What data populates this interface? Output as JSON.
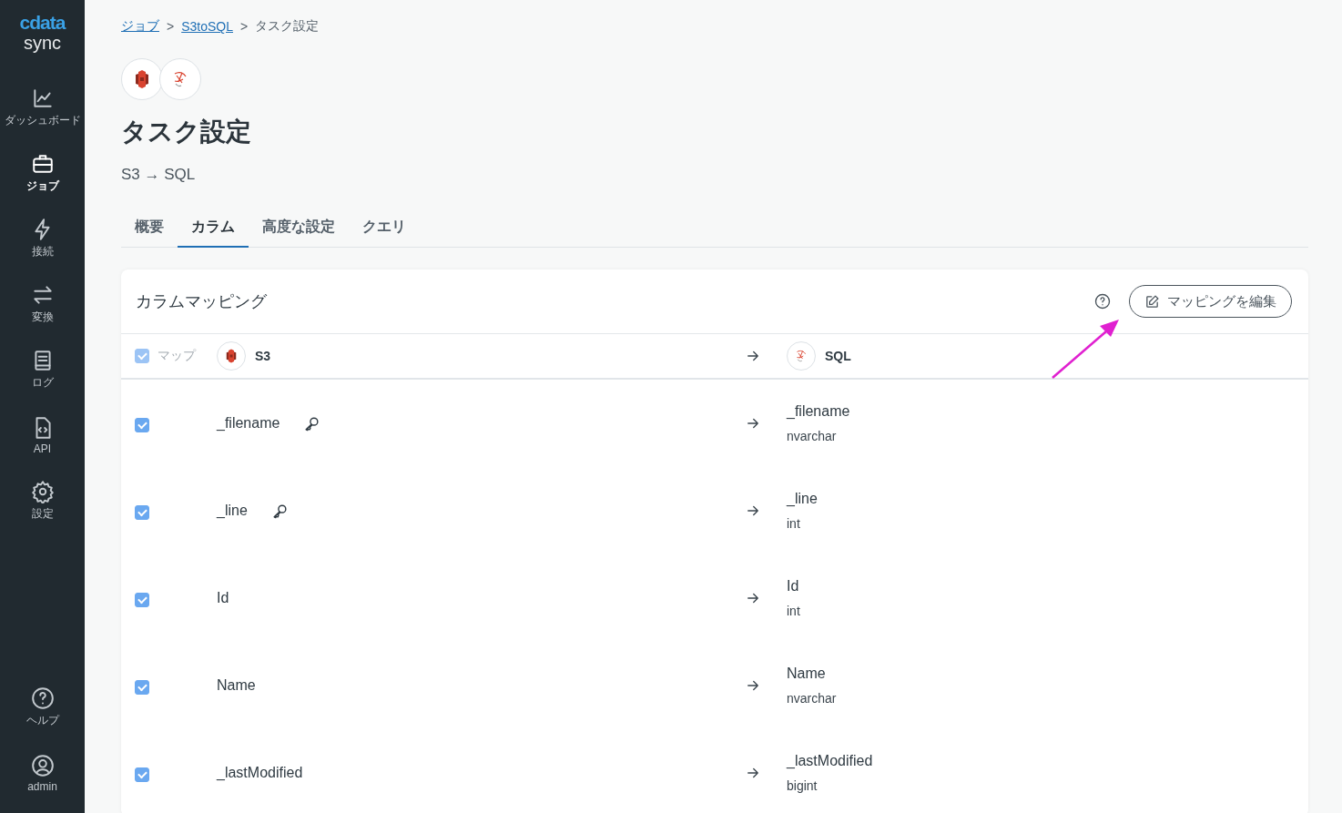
{
  "sidebar": {
    "logo": {
      "brand": "cdata",
      "product": "sync"
    },
    "items": [
      {
        "label": "ダッシュボード",
        "selected": false
      },
      {
        "label": "ジョブ",
        "selected": true
      },
      {
        "label": "接続",
        "selected": false
      },
      {
        "label": "変換",
        "selected": false
      },
      {
        "label": "ログ",
        "selected": false
      },
      {
        "label": "API",
        "selected": false
      },
      {
        "label": "設定",
        "selected": false
      }
    ],
    "bottom_items": [
      {
        "label": "ヘルプ",
        "selected": false
      },
      {
        "label": "admin",
        "selected": false
      }
    ]
  },
  "breadcrumb": [
    {
      "label": "ジョブ",
      "kind": "link"
    },
    {
      "label": "S3toSQL",
      "kind": "link"
    },
    {
      "label": "タスク設定",
      "kind": "current"
    }
  ],
  "breadcrumb_separator": ">",
  "title": "タスク設定",
  "subtitle": "S3 → SQL",
  "tabs": [
    {
      "label": "概要",
      "selected": false
    },
    {
      "label": "カラム",
      "selected": true
    },
    {
      "label": "高度な設定",
      "selected": false
    },
    {
      "label": "クエリ",
      "selected": false
    }
  ],
  "card": {
    "title": "カラムマッピング",
    "edit_button": "マッピングを編集",
    "header": {
      "map_label": "マップ",
      "map_checked": true,
      "source": "S3",
      "destination": "SQL"
    },
    "rows": [
      {
        "checked": true,
        "source": "_filename",
        "key": true,
        "target": "_filename",
        "type": "nvarchar"
      },
      {
        "checked": true,
        "source": "_line",
        "key": true,
        "target": "_line",
        "type": "int"
      },
      {
        "checked": true,
        "source": "Id",
        "key": false,
        "target": "Id",
        "type": "int"
      },
      {
        "checked": true,
        "source": "Name",
        "key": false,
        "target": "Name",
        "type": "nvarchar"
      },
      {
        "checked": true,
        "source": "_lastModified",
        "key": false,
        "target": "_lastModified",
        "type": "bigint"
      }
    ]
  }
}
